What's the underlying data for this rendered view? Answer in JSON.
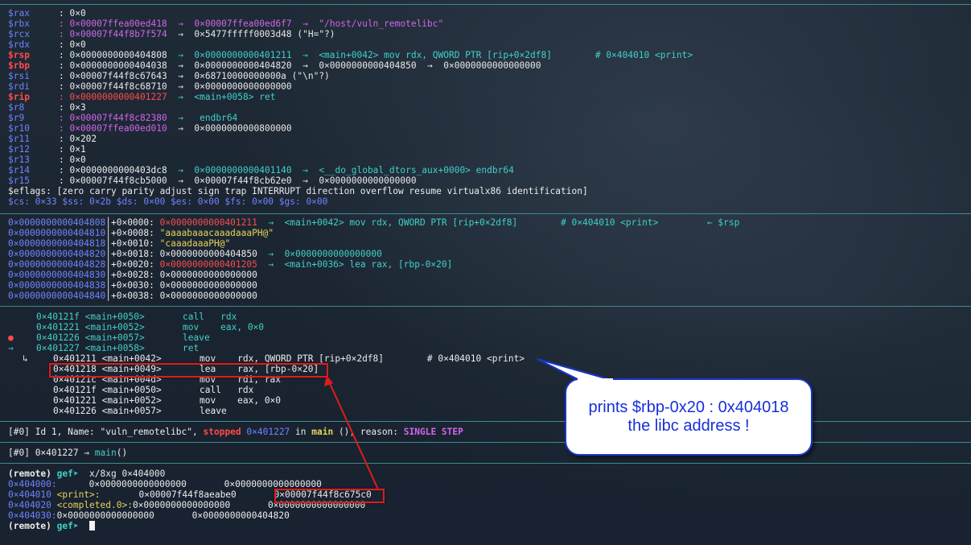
{
  "registers": [
    {
      "name": "$rax",
      "changed": false,
      "value": ": 0×0",
      "tail": ""
    },
    {
      "name": "$rbx",
      "changed": false,
      "value": ": 0×00007ffea00ed418",
      "tail": "→  0×00007ffea00ed6f7  →  \"/host/vuln_remotelibc\""
    },
    {
      "name": "$rcx",
      "changed": false,
      "value": ": 0×00007f44f8b7f574",
      "tail": "→  0×5477fffff0003d48 (\"H=\"?)"
    },
    {
      "name": "$rdx",
      "changed": false,
      "value": ": 0×0",
      "tail": ""
    },
    {
      "name": "$rsp",
      "changed": true,
      "value": ": 0×0000000000404808",
      "tail": "→  0×0000000000401211  →  <main+0042> mov rdx, QWORD PTR [rip+0×2df8]        # 0×404010 <print>"
    },
    {
      "name": "$rbp",
      "changed": true,
      "value": ": 0×0000000000404038",
      "tail": "→  0×0000000000404820  →  0×0000000000404850  →  0×0000000000000000"
    },
    {
      "name": "$rsi",
      "changed": false,
      "value": ": 0×00007f44f8c67643",
      "tail": "→  0×68710000000000a (\"\\n\"?)"
    },
    {
      "name": "$rdi",
      "changed": false,
      "value": ": 0×00007f44f8c68710",
      "tail": "→  0×0000000000000000"
    },
    {
      "name": "$rip",
      "changed": true,
      "value": ": 0×0000000000401227",
      "tail": "→  <main+0058> ret"
    },
    {
      "name": "$r8",
      "changed": false,
      "value": ": 0×3",
      "tail": ""
    },
    {
      "name": "$r9",
      "changed": false,
      "value": ": 0×00007f44f8c82380",
      "tail": "→   endbr64"
    },
    {
      "name": "$r10",
      "changed": false,
      "value": ": 0×00007ffea00ed010",
      "tail": "→  0×0000000000800000"
    },
    {
      "name": "$r11",
      "changed": false,
      "value": ": 0×202",
      "tail": ""
    },
    {
      "name": "$r12",
      "changed": false,
      "value": ": 0×1",
      "tail": ""
    },
    {
      "name": "$r13",
      "changed": false,
      "value": ": 0×0",
      "tail": ""
    },
    {
      "name": "$r14",
      "changed": false,
      "value": ": 0×0000000000403dc8",
      "tail": "→  0×0000000000401140  →  <__do_global_dtors_aux+0000> endbr64"
    },
    {
      "name": "$r15",
      "changed": false,
      "value": ": 0×00007f44f8cb5000",
      "tail": "→  0×00007f44f8cb62e0  →  0×0000000000000000"
    }
  ],
  "eflags": "$eflags: [zero carry parity adjust sign trap INTERRUPT direction overflow resume virtualx86 identification]",
  "segments": "$cs: 0×33 $ss: 0×2b $ds: 0×00 $es: 0×00 $fs: 0×00 $gs: 0×00",
  "stack": [
    {
      "addr": "0×0000000000404808",
      "off": "│+0×0000:",
      "val": "0×0000000000401211",
      "rest": "→  <main+0042> mov rdx, QWORD PTR [rip+0×2df8]        # 0×404010 <print>         ← $rsp"
    },
    {
      "addr": "0×0000000000404810",
      "off": "│+0×0008:",
      "val": "\"aaaabaaacaaadaaaPH@\"",
      "rest": ""
    },
    {
      "addr": "0×0000000000404818",
      "off": "│+0×0010:",
      "val": "\"caaadaaaPH@\"",
      "rest": ""
    },
    {
      "addr": "0×0000000000404820",
      "off": "│+0×0018:",
      "val": "0×0000000000404850",
      "rest": "→  0×0000000000000000"
    },
    {
      "addr": "0×0000000000404828",
      "off": "│+0×0020:",
      "val": "0×0000000000401205",
      "rest": "→  <main+0036> lea rax, [rbp-0×20]"
    },
    {
      "addr": "0×0000000000404830",
      "off": "│+0×0028:",
      "val": "0×0000000000000000",
      "rest": ""
    },
    {
      "addr": "0×0000000000404838",
      "off": "│+0×0030:",
      "val": "0×0000000000000000",
      "rest": ""
    },
    {
      "addr": "0×0000000000404840",
      "off": "│+0×0038:",
      "val": "0×0000000000000000",
      "rest": ""
    }
  ],
  "code": [
    {
      "marker": "",
      "addr": "0×40121f <main+0050>",
      "ins": "call   rdx",
      "style": "cyan"
    },
    {
      "marker": "",
      "addr": "0×401221 <main+0052>",
      "ins": "mov    eax, 0×0",
      "style": "cyan"
    },
    {
      "marker": "●",
      "addr": "0×401226 <main+0057>",
      "ins": "leave",
      "style": "cyan"
    },
    {
      "marker": "→",
      "addr": "0×401227 <main+0058>",
      "ins": "ret",
      "style": "cyan"
    }
  ],
  "subcode": [
    {
      "addr": "0×401211 <main+0042>",
      "ins": "mov    rdx, QWORD PTR [rip+0×2df8]        # 0×404010 <print>"
    },
    {
      "addr": "0×401218 <main+0049>",
      "ins": "lea    rax, [rbp-0×20]"
    },
    {
      "addr": "0×40121c <main+004d>",
      "ins": "mov    rdi, rax"
    },
    {
      "addr": "0×40121f <main+0050>",
      "ins": "call   rdx"
    },
    {
      "addr": "0×401221 <main+0052>",
      "ins": "mov    eax, 0×0"
    },
    {
      "addr": "0×401226 <main+0057>",
      "ins": "leave"
    }
  ],
  "subcode_marker": "↳",
  "threads": {
    "tag": "[#0]",
    "id": " Id 1, Name: \"vuln_remotelibc\", ",
    "state": "stopped",
    "addr": "0×401227",
    "in": " in ",
    "fn": "main",
    "reason_pre": " (), reason: ",
    "reason": "SINGLE STEP"
  },
  "trace": {
    "tag": "[#0]",
    "addr": " 0×401227 → ",
    "fn": "main",
    "rest": "()"
  },
  "cmd": {
    "prompt1": "(remote) ",
    "prompt2": "gef➤",
    "command": "  x/8xg 0×404000"
  },
  "memory": [
    {
      "addr": "0×404000:",
      "label": "",
      "c1": "0×0000000000000000",
      "c2": "0×0000000000000000"
    },
    {
      "addr": "0×404010",
      "label": "<print>:",
      "c1": "0×00007f44f8aeabe0",
      "c2": "0×00007f44f8c675c0"
    },
    {
      "addr": "0×404020",
      "label": "<completed.0>:",
      "c1": "0×0000000000000000",
      "c2": "0×0000000000000000"
    },
    {
      "addr": "0×404030:",
      "label": "",
      "c1": "0×0000000000000000",
      "c2": "0×0000000000404820"
    }
  ],
  "prompt_last": {
    "p1": "(remote) ",
    "p2": "gef➤"
  },
  "callout": {
    "line1": "prints $rbp-0x20 : 0x404018",
    "line2": "the libc address !"
  }
}
